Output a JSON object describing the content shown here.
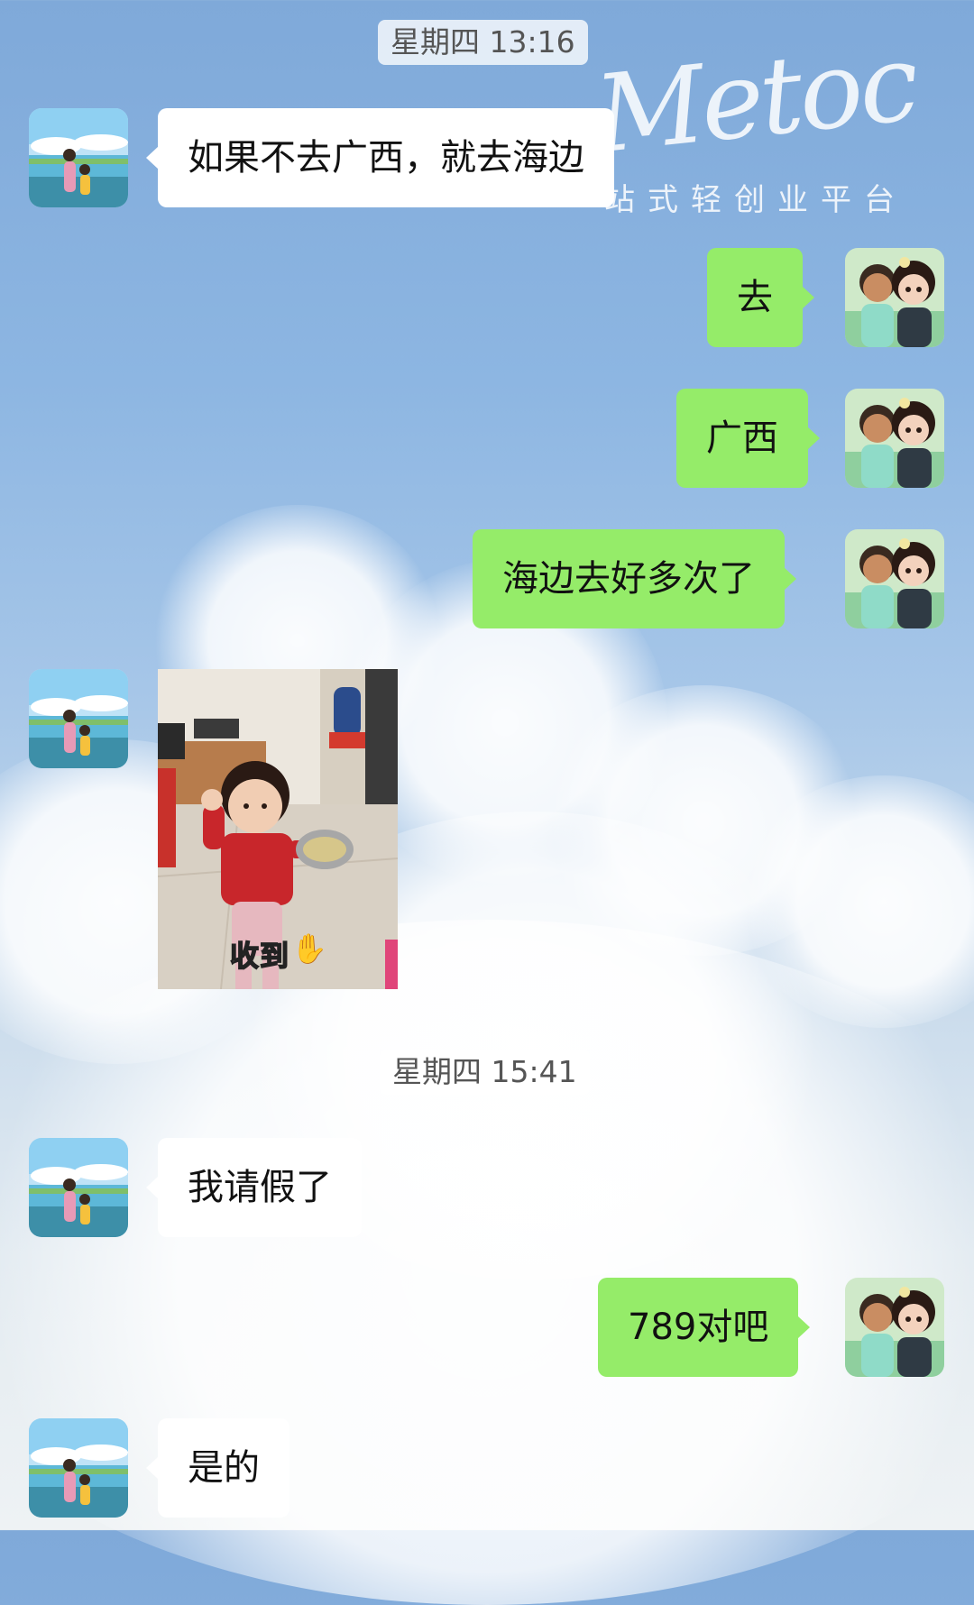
{
  "watermark": {
    "script": "Metoc",
    "subtitle": "站式轻创业平台"
  },
  "timestamps": [
    {
      "text": "星期四 13:16"
    },
    {
      "text": "星期四 15:41"
    }
  ],
  "messages": [
    {
      "sender": "contact",
      "text": "如果不去广西，就去海边"
    },
    {
      "sender": "me",
      "text": "去"
    },
    {
      "sender": "me",
      "text": "广西"
    },
    {
      "sender": "me",
      "text": "海边去好多次了"
    },
    {
      "sender": "contact",
      "type": "image",
      "caption": "收到"
    },
    {
      "sender": "contact",
      "text": "我请假了"
    },
    {
      "sender": "me",
      "text": "789对吧"
    },
    {
      "sender": "contact",
      "text": "是的"
    }
  ],
  "colors": {
    "outgoing_bubble": "#95ec69",
    "incoming_bubble": "#ffffff"
  }
}
